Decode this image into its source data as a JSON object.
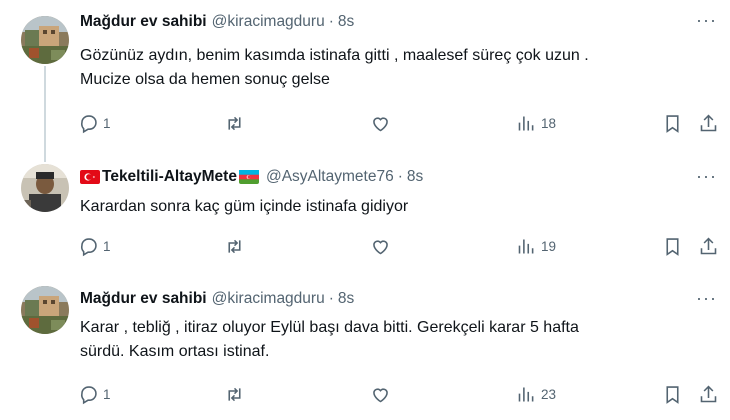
{
  "tweets": [
    {
      "name": "Mağdur ev sahibi",
      "handle": "@kiracimagduru",
      "time": "8s",
      "text_lines": [
        "Gözünüz aydın, benim kasımda istinafa gitti , maalesef süreç çok uzun .",
        "Mucize olsa da hemen sonuç gelse"
      ],
      "replies": "1",
      "retweets": "",
      "likes": "",
      "views": "18"
    },
    {
      "name": "Tekeltili-AltayMete",
      "handle": "@AsyAltaymete76",
      "time": "8s",
      "text_lines": [
        "Karardan sonra kaç güm içinde istinafa gidiyor"
      ],
      "replies": "1",
      "retweets": "",
      "likes": "",
      "views": "19"
    },
    {
      "name": "Mağdur ev sahibi",
      "handle": "@kiracimagduru",
      "time": "8s",
      "text_lines": [
        "Karar , tebliğ , itiraz oluyor Eylül başı dava bitti. Gerekçeli karar 5 hafta",
        "sürdü. Kasım ortası istinaf."
      ],
      "replies": "1",
      "retweets": "",
      "likes": "",
      "views": "23"
    }
  ],
  "dot_separator": "·",
  "more_glyph": "···",
  "icons": [
    "reply-icon",
    "retweet-icon",
    "like-icon",
    "views-icon",
    "bookmark-icon",
    "share-icon"
  ],
  "colors": {
    "text": "#0f1419",
    "secondary": "#536471",
    "thread_line": "#cfd9de"
  }
}
